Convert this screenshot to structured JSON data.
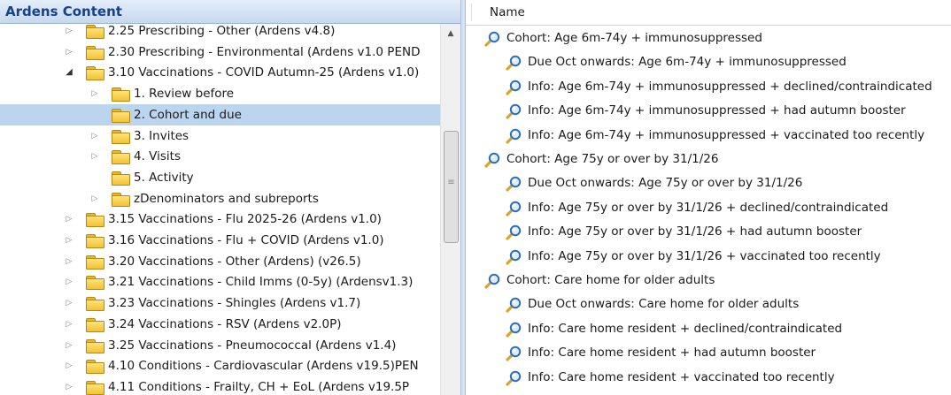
{
  "left_panel": {
    "title": "Ardens Content",
    "tree": [
      {
        "label": "2.25 Prescribing - Other (Ardens v4.8)",
        "level": 0,
        "expander": "collapsed"
      },
      {
        "label": "2.30 Prescribing - Environmental (Ardens v1.0 PEND",
        "level": 0,
        "expander": "collapsed"
      },
      {
        "label": "3.10 Vaccinations - COVID Autumn-25 (Ardens v1.0)",
        "level": 0,
        "expander": "expanded"
      },
      {
        "label": "1. Review before",
        "level": 1,
        "expander": "collapsed"
      },
      {
        "label": "2. Cohort and due",
        "level": 1,
        "expander": "none",
        "selected": true
      },
      {
        "label": "3. Invites",
        "level": 1,
        "expander": "collapsed"
      },
      {
        "label": "4. Visits",
        "level": 1,
        "expander": "collapsed"
      },
      {
        "label": "5. Activity",
        "level": 1,
        "expander": "none"
      },
      {
        "label": "zDenominators and subreports",
        "level": 1,
        "expander": "collapsed"
      },
      {
        "label": "3.15 Vaccinations - Flu 2025-26 (Ardens v1.0)",
        "level": 0,
        "expander": "collapsed"
      },
      {
        "label": "3.16 Vaccinations - Flu + COVID (Ardens v1.0)",
        "level": 0,
        "expander": "collapsed"
      },
      {
        "label": "3.20 Vaccinations - Other (Ardens) (v26.5)",
        "level": 0,
        "expander": "collapsed"
      },
      {
        "label": "3.21 Vaccinations - Child Imms (0-5y) (Ardensv1.3)",
        "level": 0,
        "expander": "collapsed"
      },
      {
        "label": "3.23 Vaccinations - Shingles (Ardens v1.7)",
        "level": 0,
        "expander": "collapsed"
      },
      {
        "label": "3.24 Vaccinations - RSV (Ardens v2.0P)",
        "level": 0,
        "expander": "collapsed"
      },
      {
        "label": "3.25 Vaccinations - Pneumococcal (Ardens v1.4)",
        "level": 0,
        "expander": "collapsed"
      },
      {
        "label": "4.10 Conditions - Cardiovascular (Ardens v19.5)PEN",
        "level": 0,
        "expander": "collapsed"
      },
      {
        "label": "4.11 Conditions - Frailty, CH + EoL (Ardens v19.5P",
        "level": 0,
        "expander": "collapsed"
      }
    ]
  },
  "right_panel": {
    "column_header": "Name",
    "items": [
      {
        "label": "Cohort: Age 6m-74y + immunosuppressed",
        "level": 0
      },
      {
        "label": "Due Oct onwards: Age 6m-74y + immunosuppressed",
        "level": 1
      },
      {
        "label": "Info: Age 6m-74y + immunosuppressed + declined/contraindicated",
        "level": 1
      },
      {
        "label": "Info: Age 6m-74y + immunosuppressed + had autumn booster",
        "level": 1
      },
      {
        "label": "Info: Age 6m-74y + immunosuppressed + vaccinated too recently",
        "level": 1
      },
      {
        "label": "Cohort: Age 75y or over by 31/1/26",
        "level": 0
      },
      {
        "label": "Due Oct onwards: Age 75y or over by 31/1/26",
        "level": 1
      },
      {
        "label": "Info: Age 75y or over by 31/1/26 + declined/contraindicated",
        "level": 1
      },
      {
        "label": "Info: Age 75y or over by 31/1/26 + had autumn booster",
        "level": 1
      },
      {
        "label": "Info: Age 75y or over by 31/1/26 + vaccinated too recently",
        "level": 1
      },
      {
        "label": "Cohort: Care home for older adults",
        "level": 0
      },
      {
        "label": "Due Oct onwards: Care home for older adults",
        "level": 1
      },
      {
        "label": "Info: Care home resident + declined/contraindicated",
        "level": 1
      },
      {
        "label": "Info: Care home resident + had autumn booster",
        "level": 1
      },
      {
        "label": "Info: Care home resident + vaccinated too recently",
        "level": 1
      }
    ]
  },
  "icons": {
    "folder": "folder-icon",
    "search": "search-report-icon",
    "scroll_up": "scroll-up-arrow-icon",
    "grip": "scrollbar-grip-icon"
  },
  "colors": {
    "header_text": "#15428b",
    "selection": "#bcd5ef",
    "folder": "#f3c235",
    "search_lens": "#2f6fb8",
    "search_handle": "#d8a526"
  }
}
